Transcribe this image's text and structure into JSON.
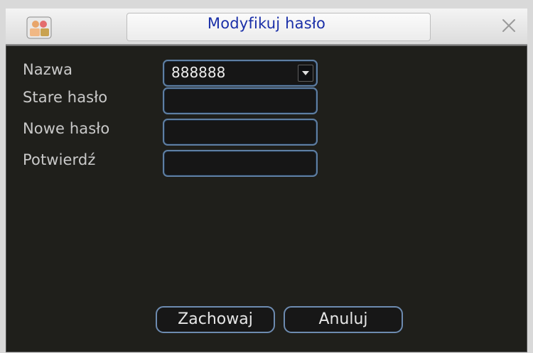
{
  "dialog": {
    "title": "Modyfikuj hasło",
    "app_icon": "app-logo-icon",
    "close_icon": "close-icon"
  },
  "form": {
    "name_label": "Nazwa",
    "name_value": "888888",
    "old_password_label": "Stare hasło",
    "old_password_value": "",
    "new_password_label": "Nowe hasło",
    "new_password_value": "",
    "confirm_label": "Potwierdź",
    "confirm_value": ""
  },
  "buttons": {
    "save_label": "Zachowaj",
    "cancel_label": "Anuluj"
  },
  "colors": {
    "title_text": "#1a2fa8",
    "panel_bg": "#1f1f1b",
    "field_border": "#5f7fa3"
  }
}
